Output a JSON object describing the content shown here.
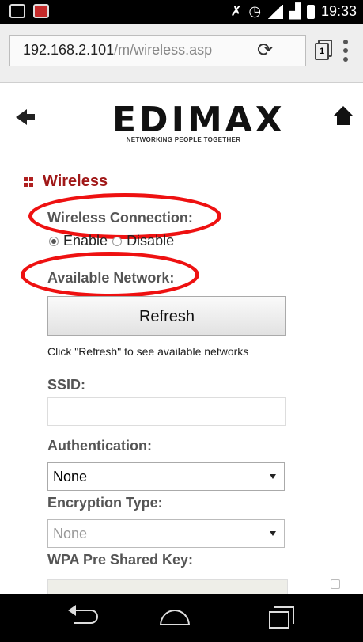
{
  "status_bar": {
    "time": "19:33",
    "icons": [
      "gallery-icon",
      "app-notification-icon",
      "mute-icon",
      "alarm-icon",
      "wifi-icon",
      "signal-icon",
      "battery-icon"
    ]
  },
  "browser": {
    "url_host": "192.168.2.101",
    "url_path": "/m/wireless.asp",
    "tab_count": "1"
  },
  "header": {
    "logo_name": "EDIMAX",
    "logo_tagline": "NETWORKING PEOPLE TOGETHER"
  },
  "section": {
    "title": "Wireless"
  },
  "form": {
    "wireless_connection_label": "Wireless Connection:",
    "enable_label": "Enable",
    "disable_label": "Disable",
    "available_network_label": "Available Network:",
    "refresh_button": "Refresh",
    "refresh_hint": "Click \"Refresh\" to see available networks",
    "ssid_label": "SSID:",
    "ssid_value": "",
    "authentication_label": "Authentication:",
    "authentication_value": "None",
    "encryption_label": "Encryption Type:",
    "encryption_value": "None",
    "wpa_key_label": "WPA Pre Shared Key:"
  },
  "colors": {
    "accent_red": "#a01818",
    "annotation_red": "#e11111"
  }
}
